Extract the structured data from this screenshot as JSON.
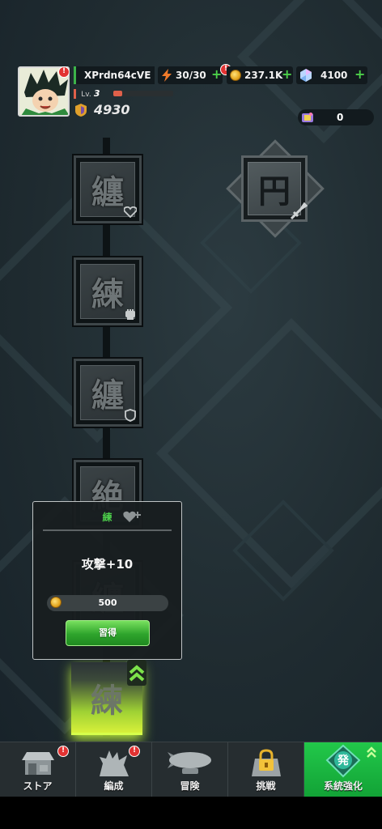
{
  "player": {
    "name": "XPrdn64cVE",
    "level_label": "Lv.",
    "level": "3",
    "exp_fraction": 0.15,
    "power": "4930"
  },
  "resources": {
    "stamina": "30/30",
    "coins": "237.1K",
    "gems": "4100",
    "tickets": "0"
  },
  "badges": {
    "avatar": "!",
    "stamina": "!",
    "store": "!",
    "formation": "!"
  },
  "skill_nodes": [
    {
      "glyph": "纏",
      "corner_icon": "heart-icon",
      "state": "locked"
    },
    {
      "glyph": "練",
      "corner_icon": "fist-icon",
      "state": "locked"
    },
    {
      "glyph": "纏",
      "corner_icon": "shield-icon",
      "state": "locked"
    },
    {
      "glyph": "絶",
      "corner_icon": "",
      "state": "locked"
    },
    {
      "glyph": "纏",
      "corner_icon": "",
      "state": "locked"
    },
    {
      "glyph": "練",
      "corner_icon": "",
      "state": "active"
    }
  ],
  "special_node": {
    "glyph": "円",
    "corner_icon": "sword-icon"
  },
  "popup": {
    "title": "練",
    "effect": "攻撃+10",
    "cost": "500",
    "learn_label": "習得"
  },
  "nav": [
    {
      "label": "ストア",
      "icon": "store-icon"
    },
    {
      "label": "編成",
      "icon": "team-icon"
    },
    {
      "label": "冒険",
      "icon": "airship-icon"
    },
    {
      "label": "挑戦",
      "icon": "lock-icon"
    },
    {
      "label": "系統強化",
      "icon": "nen-icon",
      "active": true
    }
  ],
  "nav_active_glyph": "発",
  "colors": {
    "accent_green": "#12a236",
    "badge_red": "#e23232",
    "active_glow": "#d7f03a"
  }
}
